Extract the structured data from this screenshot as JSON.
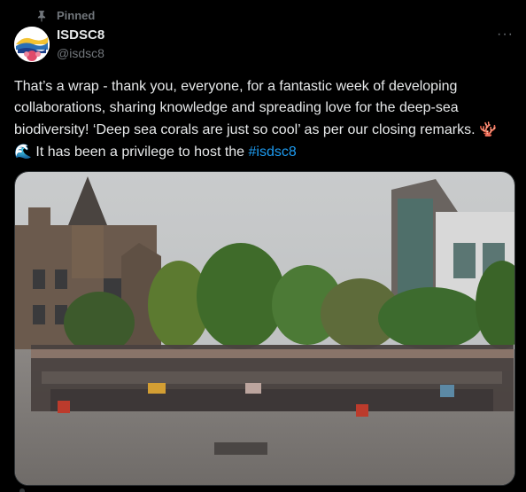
{
  "pinned_label": "Pinned",
  "account": {
    "name": "ISDSC8",
    "handle": "@isdsc8"
  },
  "more_label": "···",
  "post": {
    "line1": "That’s a wrap - thank you, everyone, for a fantastic week of developing collaborations, sharing knowledge and spreading love for the deep-sea biodiversity! ‘Deep sea corals are just so cool’ as per our closing remarks. ",
    "emojis": "🪸🌊",
    "line2": " It has been a privilege to host the ",
    "hashtag": "#isdsc8"
  },
  "media": {
    "icon": "group-photo"
  },
  "colors": {
    "background": "#000000",
    "text": "#e7e9ea",
    "secondary": "#71767b",
    "link": "#1d9bf0"
  }
}
